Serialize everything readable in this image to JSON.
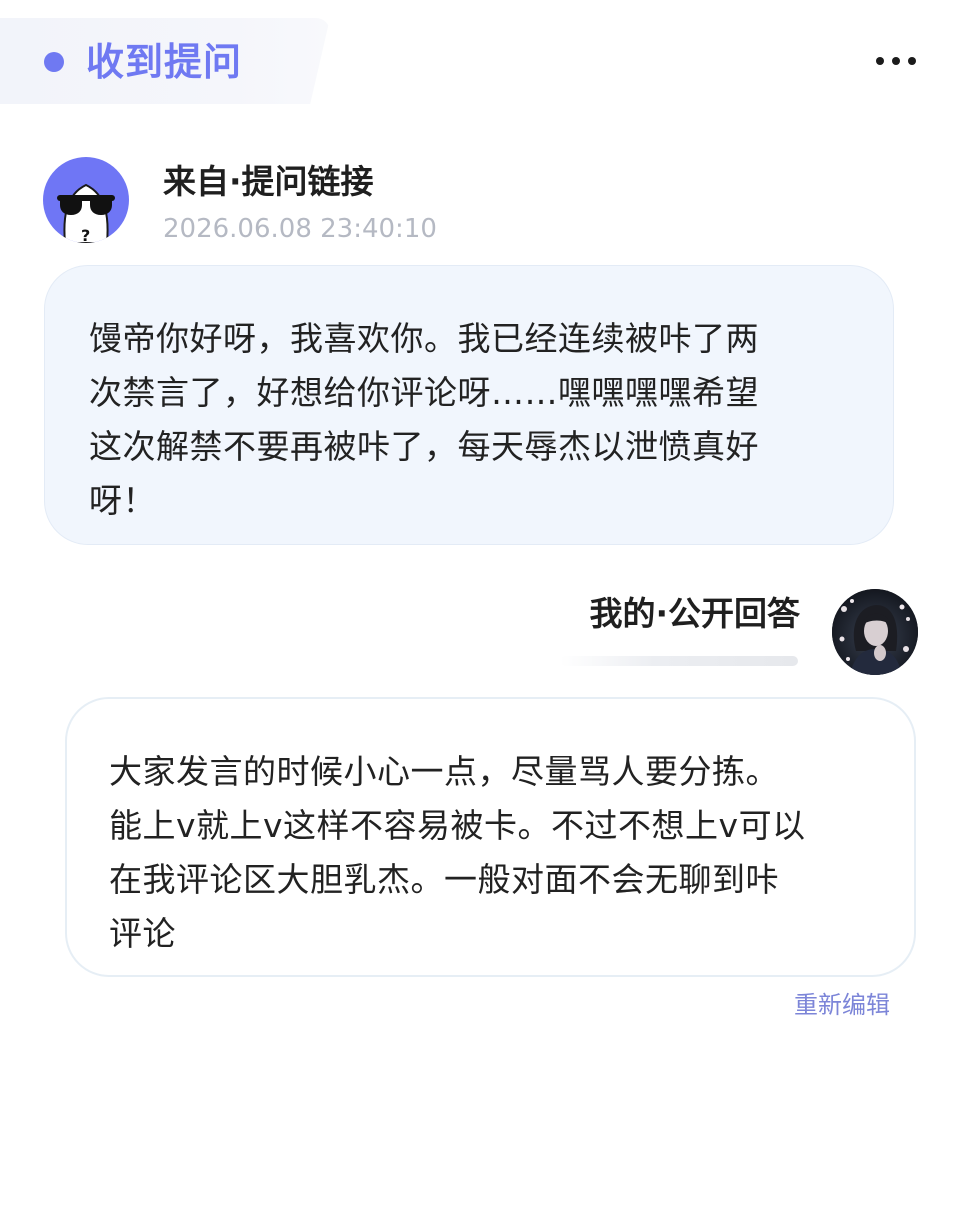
{
  "header": {
    "title": "收到提问",
    "more_icon": "more-horizontal-icon",
    "accent_color": "#6f79f2"
  },
  "question": {
    "source_label": "来自·提问链接",
    "timestamp": "2026.06.08 23:40:10",
    "avatar_icon": "anonymous-sunglasses-icon",
    "text": "馒帝你好呀，我喜欢你。我已经连续被咔了两\n次禁言了，好想给你评论呀……嘿嘿嘿嘿希望\n这次解禁不要再被咔了，每天辱杰以泄愤真好\n呀！"
  },
  "answer": {
    "label": "我的·公开回答",
    "avatar": "user-avatar-photo",
    "text": "大家发言的时候小心一点，尽量骂人要分拣。\n能上v就上v这样不容易被卡。不过不想上v可以\n在我评论区大胆乳杰。一般对面不会无聊到咔\n评论",
    "reedit_label": "重新编辑"
  }
}
